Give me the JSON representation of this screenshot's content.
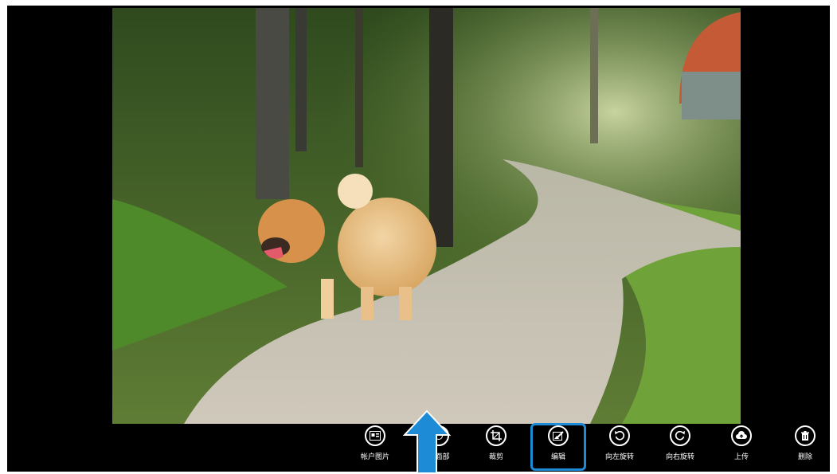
{
  "photo": {
    "subject": "dog-on-forest-path-photo"
  },
  "appbar": {
    "commands": [
      {
        "label": "帐户图片",
        "icon": "account-picture-icon"
      },
      {
        "label": "…面部",
        "icon": "face-icon"
      },
      {
        "label": "裁剪",
        "icon": "crop-icon"
      },
      {
        "label": "编辑",
        "icon": "edit-icon"
      },
      {
        "label": "向左旋转",
        "icon": "rotate-left-icon"
      },
      {
        "label": "向右旋转",
        "icon": "rotate-right-icon"
      },
      {
        "label": "上传",
        "icon": "upload-icon"
      },
      {
        "label": "删除",
        "icon": "delete-icon"
      }
    ]
  },
  "annotation": {
    "highlight_color": "#1d8bd6",
    "arrow_color": "#1d8bd6"
  }
}
